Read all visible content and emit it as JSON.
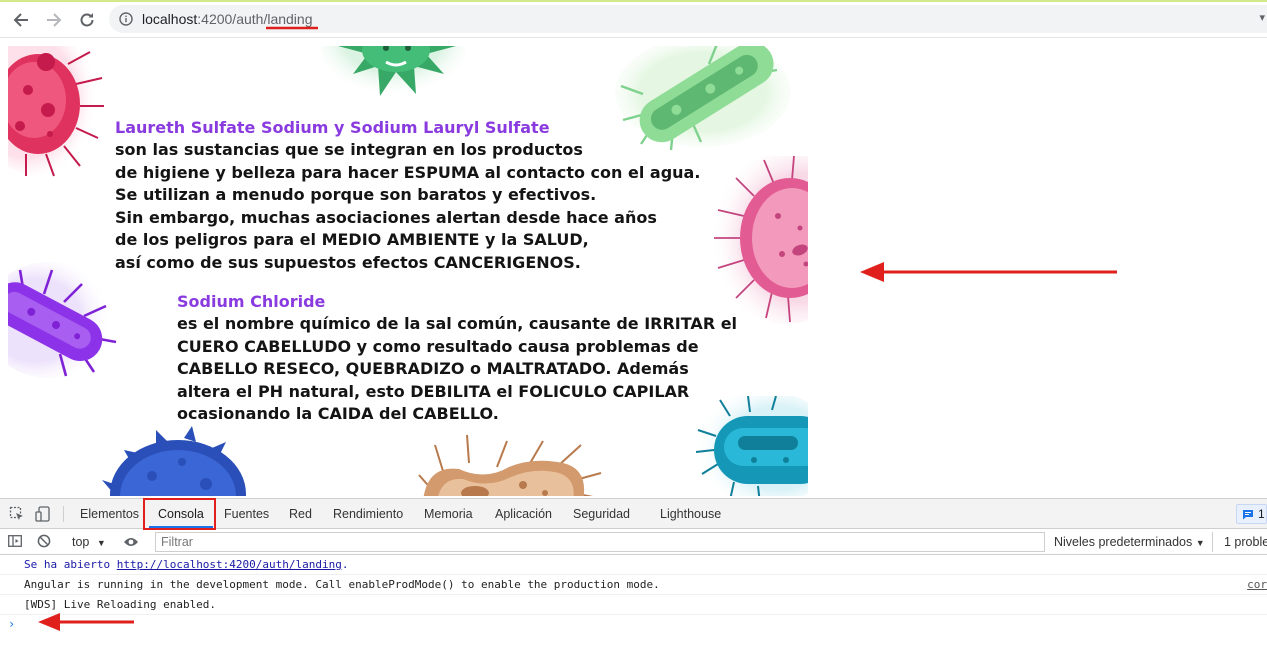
{
  "browser": {
    "url_host": "localhost",
    "url_port": ":4200/auth/",
    "url_path": "landing"
  },
  "landing": {
    "section1": {
      "heading": "Laureth Sulfate Sodium y Sodium Lauryl Sulfate",
      "lines": [
        "son las sustancias que se integran en los productos",
        "de higiene y belleza para hacer ESPUMA al contacto con el agua.",
        "Se utilizan a menudo porque son baratos y efectivos.",
        "Sin embargo, muchas asociaciones alertan desde hace años",
        "de los peligros para el MEDIO AMBIENTE y la SALUD,",
        "así como de sus supuestos efectos CANCERIGENOS."
      ]
    },
    "section2": {
      "heading": "Sodium Chloride",
      "lines": [
        "es el nombre químico de la sal común, causante de IRRITAR el",
        "CUERO CABELLUDO y como resultado causa problemas de",
        "CABELLO RESECO, QUEBRADIZO o MALTRATADO. Además",
        "altera el PH natural, esto DEBILITA el FOLICULO CAPILAR",
        "ocasionando la CAIDA del CABELLO."
      ]
    }
  },
  "devtools": {
    "tabs": [
      "Elementos",
      "Consola",
      "Fuentes",
      "Red",
      "Rendimiento",
      "Memoria",
      "Aplicación",
      "Seguridad",
      "Lighthouse"
    ],
    "active_tab": "Consola",
    "issues_count": "1",
    "context": "top",
    "filter_placeholder": "Filtrar",
    "levels": "Niveles predeterminados",
    "problems": "1 proble",
    "logs": {
      "opened_prefix": "Se ha abierto ",
      "opened_url": "http://localhost:4200/auth/landing",
      "opened_suffix": ".",
      "angular": "Angular is running in the development mode. Call enableProdMode() to enable the production mode.",
      "angular_source": "cor",
      "wds": "[WDS] Live Reloading enabled."
    },
    "prompt": "›"
  },
  "colors": {
    "heading": "#8a3be0",
    "annotation": "#e0201c",
    "accent": "#1a73e8"
  }
}
